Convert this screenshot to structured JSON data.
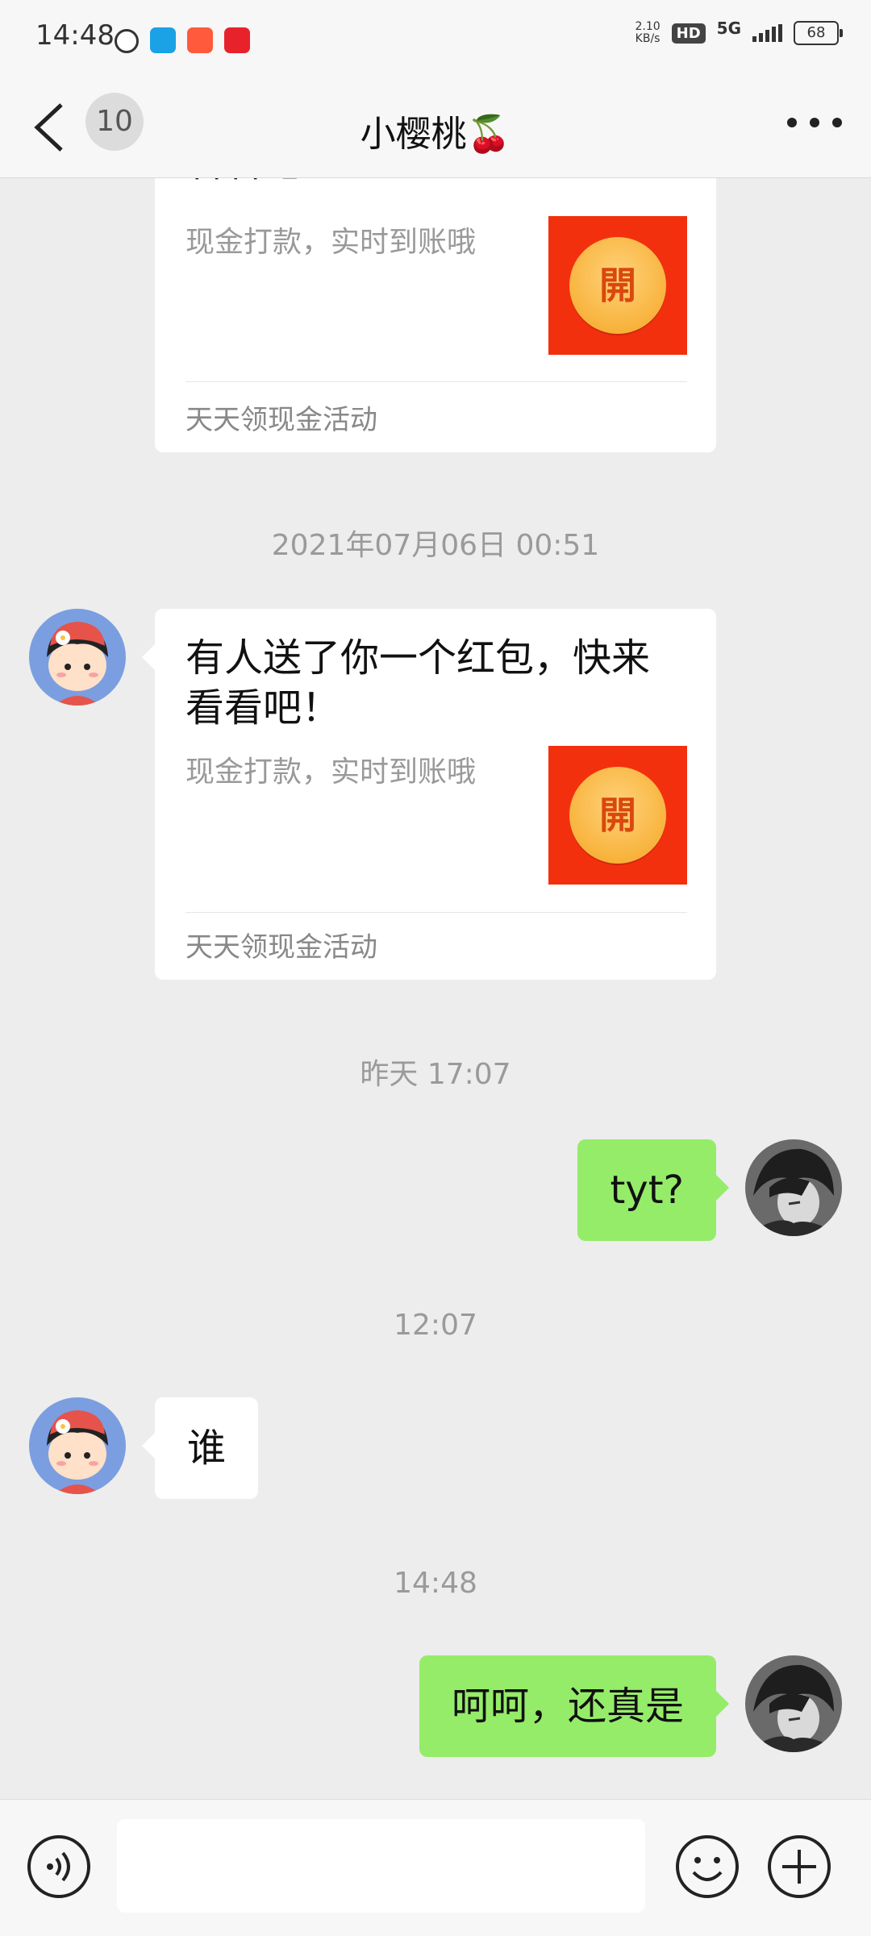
{
  "status_bar": {
    "time": "14:48",
    "net_speed_value": "2.10",
    "net_speed_unit": "KB/s",
    "hd_label": "HD",
    "network_label": "5G",
    "battery": "68"
  },
  "header": {
    "back_count": "10",
    "title": "小樱桃🍒"
  },
  "messages": {
    "card1": {
      "title_tail": "看看吧！",
      "subtitle": "现金打款，实时到账哦",
      "thumb_label": "開",
      "footer": "天天领现金活动"
    },
    "time1": "2021年07月06日 00:51",
    "card2": {
      "title": "有人送了你一个红包，快来看看吧！",
      "subtitle": "现金打款，实时到账哦",
      "thumb_label": "開",
      "footer": "天天领现金活动"
    },
    "time2": "昨天 17:07",
    "msg_out1": "tyt?",
    "time3": "12:07",
    "msg_in1": "谁",
    "time4": "14:48",
    "msg_out2": "呵呵，还真是"
  },
  "input": {
    "placeholder": ""
  },
  "colors": {
    "outgoing_bubble": "#95ec69",
    "red_packet": "#f3300e",
    "background": "#ededed"
  },
  "icons": [
    "back-arrow-icon",
    "more-icon",
    "voice-icon",
    "emoji-icon",
    "plus-icon"
  ]
}
